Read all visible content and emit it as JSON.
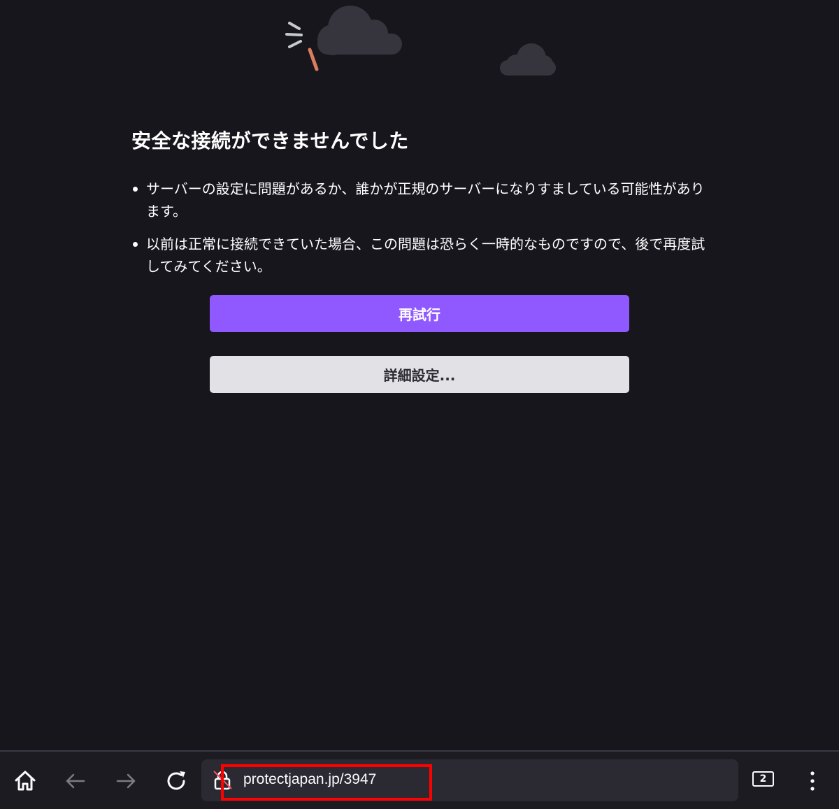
{
  "error_page": {
    "title": "安全な接続ができませんでした",
    "reasons": [
      "サーバーの設定に問題があるか、誰かが正規のサーバーになりすましている可能性があります。",
      "以前は正常に接続できていた場合、この問題は恐らく一時的なものですので、後で再度試してみてください。"
    ],
    "retry_button": "再試行",
    "advanced_button": "詳細設定..."
  },
  "toolbar": {
    "home_icon": "home-icon",
    "back_icon": "arrow-left-icon",
    "forward_icon": "arrow-right-icon",
    "reload_icon": "reload-icon",
    "security_icon": "insecure-lock-icon",
    "url": "protectjapan.jp/3947",
    "tab_count": "2",
    "menu_icon": "three-dots-vertical-icon"
  },
  "colors": {
    "background": "#17161d",
    "primary_button": "#9059ff",
    "secondary_button": "#e2e1e6",
    "highlight": "#ff0000"
  }
}
